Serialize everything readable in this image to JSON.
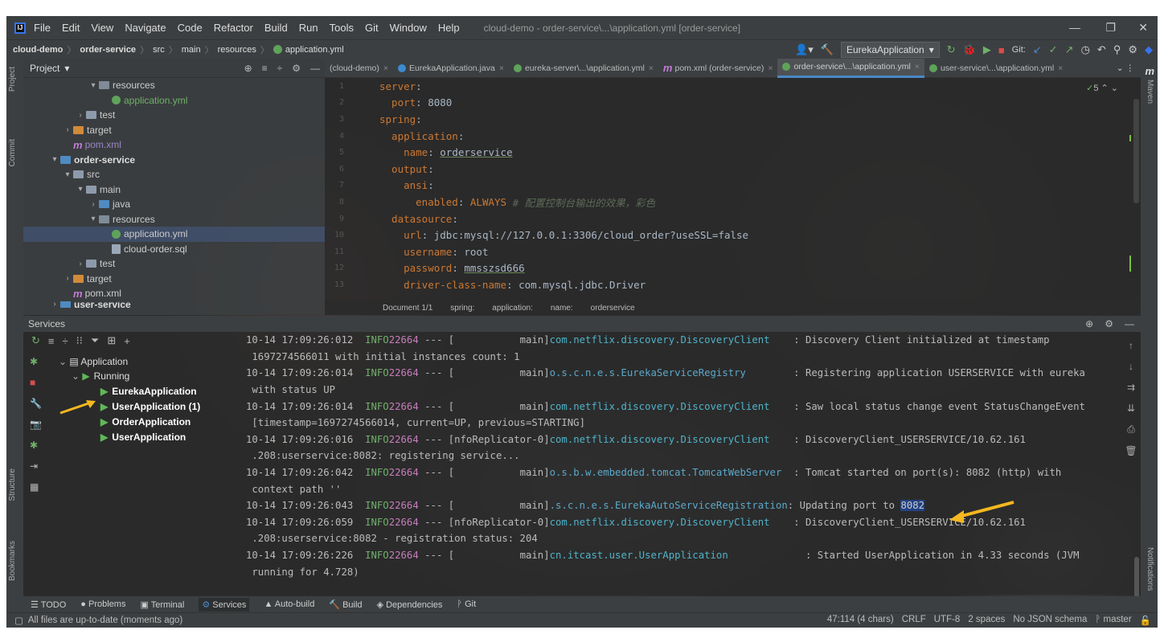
{
  "menubar": {
    "items": [
      "File",
      "Edit",
      "View",
      "Navigate",
      "Code",
      "Refactor",
      "Build",
      "Run",
      "Tools",
      "Git",
      "Window",
      "Help"
    ],
    "mnemonics": [
      "F",
      "E",
      "V",
      "N",
      "C",
      "R",
      "B",
      "u",
      "T",
      "G",
      "W",
      "H"
    ],
    "title": "cloud-demo - order-service\\...\\application.yml [order-service]"
  },
  "navbar": {
    "crumbs": [
      "cloud-demo",
      "order-service",
      "src",
      "main",
      "resources",
      "application.yml"
    ],
    "run_config": "EurekaApplication",
    "git_label": "Git:"
  },
  "project": {
    "header": "Project",
    "rows": [
      {
        "label": "resources"
      },
      {
        "label": "application.yml"
      },
      {
        "label": "test"
      },
      {
        "label": "target"
      },
      {
        "label": "pom.xml"
      },
      {
        "label": "order-service"
      },
      {
        "label": "src"
      },
      {
        "label": "main"
      },
      {
        "label": "java"
      },
      {
        "label": "resources"
      },
      {
        "label": "application.yml"
      },
      {
        "label": "cloud-order.sql"
      },
      {
        "label": "test"
      },
      {
        "label": "target"
      },
      {
        "label": "pom.xml"
      },
      {
        "label": "user-service"
      }
    ]
  },
  "tabs": [
    {
      "label": "(cloud-demo)",
      "active": false
    },
    {
      "label": "EurekaApplication.java",
      "active": false
    },
    {
      "label": "eureka-server\\...\\application.yml",
      "active": false
    },
    {
      "label": "pom.xml (order-service)",
      "active": false
    },
    {
      "label": "order-service\\...\\application.yml",
      "active": true
    },
    {
      "label": "user-service\\...\\application.yml",
      "active": false
    }
  ],
  "editor": {
    "inspection_count": "5",
    "lines": [
      {
        "n": "1",
        "key": "server",
        "sep": ":",
        "val": ""
      },
      {
        "n": "2",
        "key": "  port",
        "sep": ": ",
        "val": "8080"
      },
      {
        "n": "3",
        "key": "spring",
        "sep": ":",
        "val": ""
      },
      {
        "n": "4",
        "key": "  application",
        "sep": ":",
        "val": ""
      },
      {
        "n": "5",
        "key": "    name",
        "sep": ": ",
        "val": "orderservice"
      },
      {
        "n": "6",
        "key": "  output",
        "sep": ":",
        "val": ""
      },
      {
        "n": "7",
        "key": "    ansi",
        "sep": ":",
        "val": ""
      },
      {
        "n": "8",
        "key": "      enabled",
        "sep": ": ",
        "val": "ALWAYS",
        "comment": " # 配置控制台输出的效果，彩色"
      },
      {
        "n": "9",
        "key": "  datasource",
        "sep": ":",
        "val": ""
      },
      {
        "n": "10",
        "key": "    url",
        "sep": ": ",
        "val": "jdbc:mysql://127.0.0.1:3306/cloud_order?useSSL=false"
      },
      {
        "n": "11",
        "key": "    username",
        "sep": ": ",
        "val": "root"
      },
      {
        "n": "12",
        "key": "    password",
        "sep": ": ",
        "val": "mmsszsd666"
      },
      {
        "n": "13",
        "key": "    driver-class-name",
        "sep": ": ",
        "val": "com.mysql.jdbc.Driver"
      }
    ],
    "breadcrumb": [
      "Document 1/1",
      "spring:",
      "application:",
      "name:",
      "orderservice"
    ]
  },
  "services": {
    "header": "Services",
    "tree": {
      "group": "Application",
      "running": "Running",
      "apps": [
        "EurekaApplication",
        "UserApplication (1)",
        "OrderApplication",
        "UserApplication"
      ]
    },
    "logs": [
      {
        "t": "10-14 17:09:26:012",
        "lvl": "INFO",
        "pid": "22664",
        "sep": " --- [",
        "th": "           main]",
        "cls": "com.netflix.discovery.DiscoveryClient",
        "pad": "    ",
        "msg": ": Discovery Client initialized at timestamp"
      },
      {
        "cont": " 1697274566011 with initial instances count: 1"
      },
      {
        "t": "10-14 17:09:26:014",
        "lvl": "INFO",
        "pid": "22664",
        "sep": " --- [",
        "th": "           main]",
        "cls": "o.s.c.n.e.s.EurekaServiceRegistry",
        "pad": "        ",
        "msg": ": Registering application USERSERVICE with eureka"
      },
      {
        "cont": " with status UP"
      },
      {
        "t": "10-14 17:09:26:014",
        "lvl": "INFO",
        "pid": "22664",
        "sep": " --- [",
        "th": "           main]",
        "cls": "com.netflix.discovery.DiscoveryClient",
        "pad": "    ",
        "msg": ": Saw local status change event StatusChangeEvent"
      },
      {
        "cont": " [timestamp=1697274566014, current=UP, previous=STARTING]"
      },
      {
        "t": "10-14 17:09:26:016",
        "lvl": "INFO",
        "pid": "22664",
        "sep": " --- [",
        "th": "nfoReplicator-0]",
        "cls": "com.netflix.discovery.DiscoveryClient",
        "pad": "    ",
        "msg": ": DiscoveryClient_USERSERVICE/10.62.161"
      },
      {
        "cont": " .208:userservice:8082: registering service..."
      },
      {
        "t": "10-14 17:09:26:042",
        "lvl": "INFO",
        "pid": "22664",
        "sep": " --- [",
        "th": "           main]",
        "cls": "o.s.b.w.embedded.tomcat.TomcatWebServer",
        "pad": "  ",
        "msg": ": Tomcat started on port(s): 8082 (http) with"
      },
      {
        "cont": " context path ''"
      },
      {
        "t": "10-14 17:09:26:043",
        "lvl": "INFO",
        "pid": "22664",
        "sep": " --- [",
        "th": "           main]",
        "cls": ".s.c.n.e.s.EurekaAutoServiceRegistration",
        "pad": "",
        "msg": ": Updating port to ",
        "hl": "8082"
      },
      {
        "t": "10-14 17:09:26:059",
        "lvl": "INFO",
        "pid": "22664",
        "sep": " --- [",
        "th": "nfoReplicator-0]",
        "cls": "com.netflix.discovery.DiscoveryClient",
        "pad": "    ",
        "msg": ": DiscoveryClient_USERSERVICE/10.62.161"
      },
      {
        "cont": " .208:userservice:8082 - registration status: 204"
      },
      {
        "t": "10-14 17:09:26:226",
        "lvl": "INFO",
        "pid": "22664",
        "sep": " --- [",
        "th": "           main]",
        "cls": "cn.itcast.user.UserApplication",
        "pad": "             ",
        "msg": ": Started UserApplication in 4.33 seconds (JVM"
      },
      {
        "cont": " running for 4.728)"
      }
    ]
  },
  "toolwindows": [
    "TODO",
    "Problems",
    "Terminal",
    "Services",
    "Auto-build",
    "Build",
    "Dependencies",
    "Git"
  ],
  "status": {
    "left": "All files are up-to-date (moments ago)",
    "position": "47:114 (4 chars)",
    "line_sep": "CRLF",
    "encoding": "UTF-8",
    "indent": "2 spaces",
    "schema": "No JSON schema",
    "branch": "master"
  },
  "stripes": {
    "project": "Project",
    "commit": "Commit",
    "structure": "Structure",
    "bookmarks": "Bookmarks",
    "maven": "Maven",
    "notifications": "Notifications"
  },
  "colors": {
    "accent": "#4a88c7",
    "annotation_arrow": "#f5b820",
    "yaml_key": "#cc7832"
  }
}
